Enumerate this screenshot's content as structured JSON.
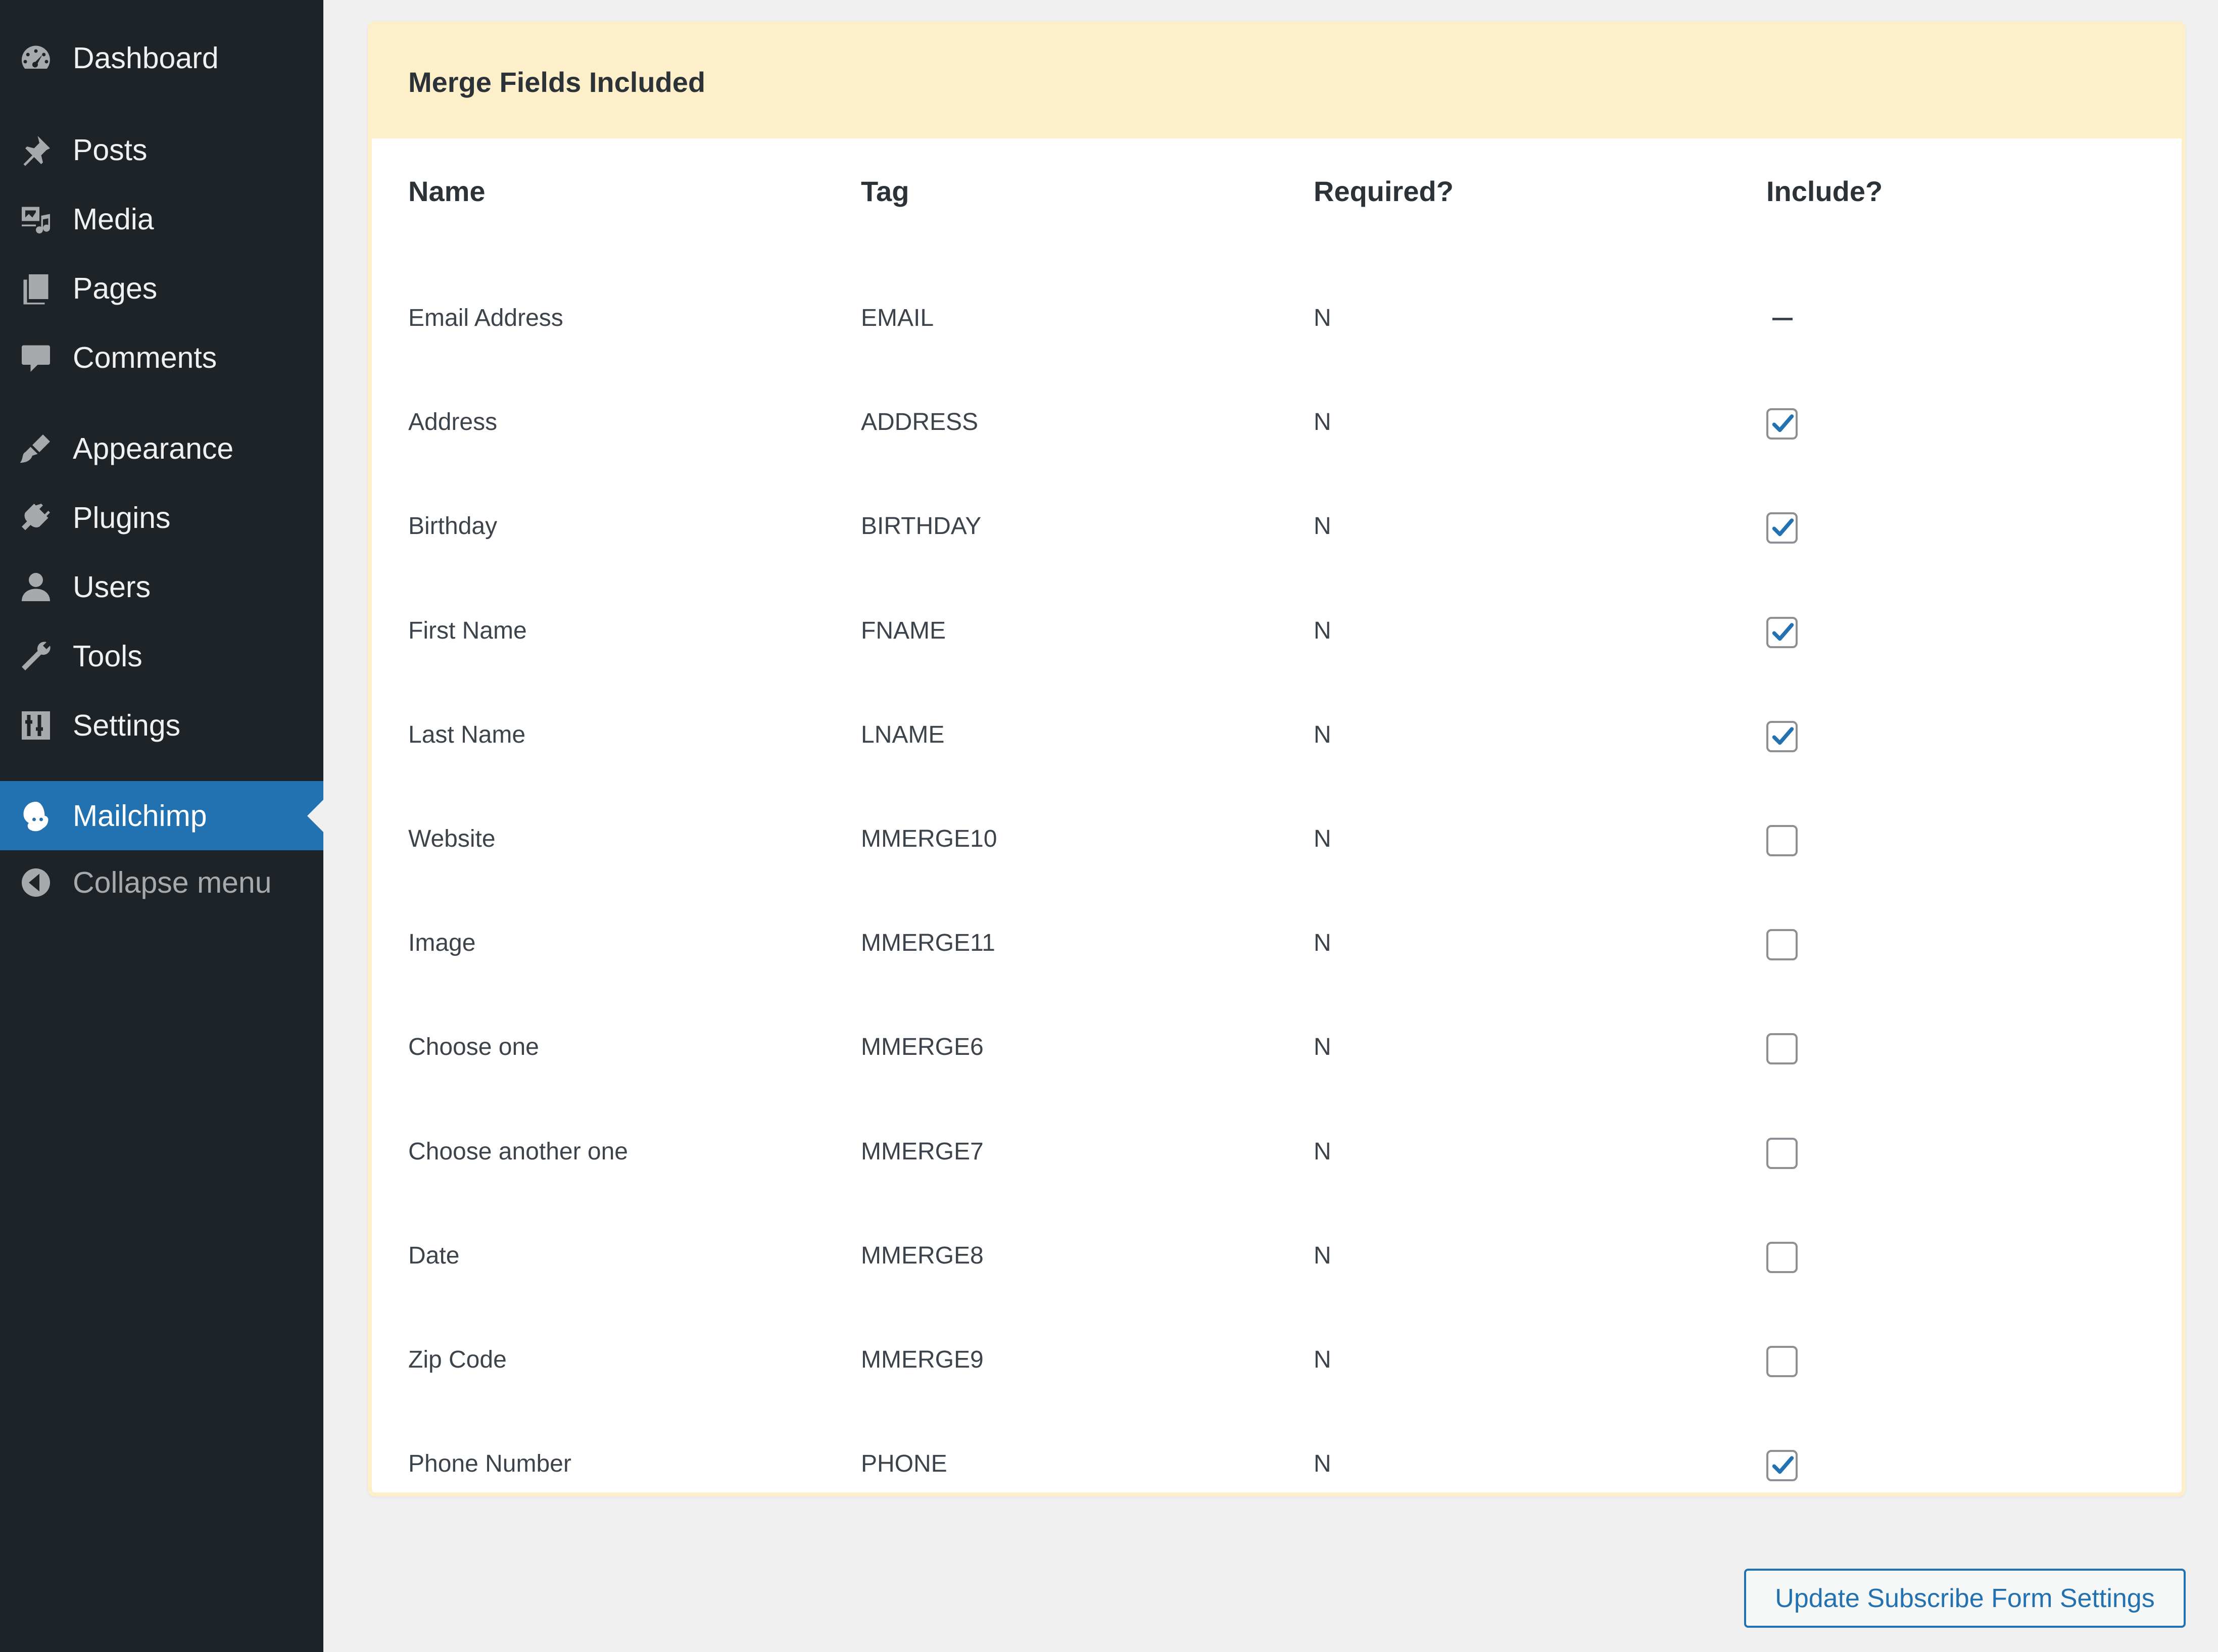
{
  "sidebar": {
    "items": [
      {
        "label": "Dashboard",
        "icon": "dashboard-icon"
      },
      {
        "label": "Posts",
        "icon": "pushpin-icon"
      },
      {
        "label": "Media",
        "icon": "media-icon"
      },
      {
        "label": "Pages",
        "icon": "pages-icon"
      },
      {
        "label": "Comments",
        "icon": "comment-bubble-icon"
      },
      {
        "label": "Appearance",
        "icon": "paintbrush-icon"
      },
      {
        "label": "Plugins",
        "icon": "plug-icon"
      },
      {
        "label": "Users",
        "icon": "user-icon"
      },
      {
        "label": "Tools",
        "icon": "wrench-icon"
      },
      {
        "label": "Settings",
        "icon": "sliders-icon"
      },
      {
        "label": "Mailchimp",
        "icon": "mailchimp-icon",
        "active": true
      },
      {
        "label": "Collapse menu",
        "icon": "collapse-arrow-icon"
      }
    ]
  },
  "panel": {
    "title": "Merge Fields Included",
    "columns": {
      "name": "Name",
      "tag": "Tag",
      "required": "Required?",
      "include": "Include?"
    },
    "rows": [
      {
        "name": "Email Address",
        "tag": "EMAIL",
        "required": "N",
        "include": "dash"
      },
      {
        "name": "Address",
        "tag": "ADDRESS",
        "required": "N",
        "include": "checked"
      },
      {
        "name": "Birthday",
        "tag": "BIRTHDAY",
        "required": "N",
        "include": "checked"
      },
      {
        "name": "First Name",
        "tag": "FNAME",
        "required": "N",
        "include": "checked"
      },
      {
        "name": "Last Name",
        "tag": "LNAME",
        "required": "N",
        "include": "checked"
      },
      {
        "name": "Website",
        "tag": "MMERGE10",
        "required": "N",
        "include": "unchecked"
      },
      {
        "name": "Image",
        "tag": "MMERGE11",
        "required": "N",
        "include": "unchecked"
      },
      {
        "name": "Choose one",
        "tag": "MMERGE6",
        "required": "N",
        "include": "unchecked"
      },
      {
        "name": "Choose another one",
        "tag": "MMERGE7",
        "required": "N",
        "include": "unchecked"
      },
      {
        "name": "Date",
        "tag": "MMERGE8",
        "required": "N",
        "include": "unchecked"
      },
      {
        "name": "Zip Code",
        "tag": "MMERGE9",
        "required": "N",
        "include": "unchecked"
      },
      {
        "name": "Phone Number",
        "tag": "PHONE",
        "required": "N",
        "include": "checked"
      }
    ]
  },
  "submit": {
    "label": "Update Subscribe Form Settings"
  },
  "colors": {
    "sidebar_bg": "#1d2327",
    "active_bg": "#2271b1",
    "panel_header_bg": "#fcefc9",
    "accent": "#2271b1"
  }
}
